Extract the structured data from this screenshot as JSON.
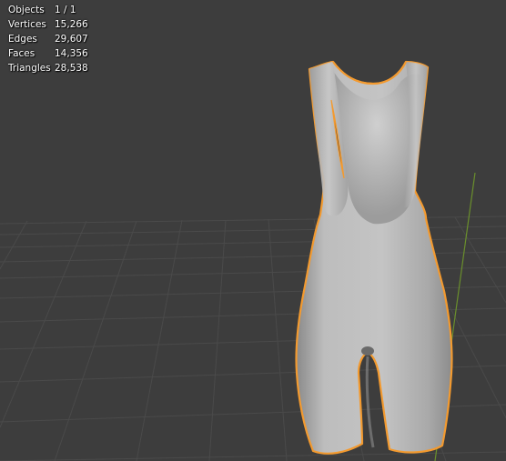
{
  "viewport": {
    "stats": [
      {
        "label": "Objects",
        "value": "1 / 1"
      },
      {
        "label": "Vertices",
        "value": "15,266"
      },
      {
        "label": "Edges",
        "value": "29,607"
      },
      {
        "label": "Faces",
        "value": "14,356"
      },
      {
        "label": "Triangles",
        "value": "28,538"
      }
    ],
    "colors": {
      "background": "#3d3d3d",
      "grid_line": "#4a4a4a",
      "y_axis": "#6a8f2c",
      "selection_outline": "#f39a2f",
      "mesh_light": "#c9c9c9",
      "mesh_shadow": "#7a7a7a"
    },
    "object": {
      "name_icon": "bib-shorts-mesh",
      "selected": true
    }
  }
}
